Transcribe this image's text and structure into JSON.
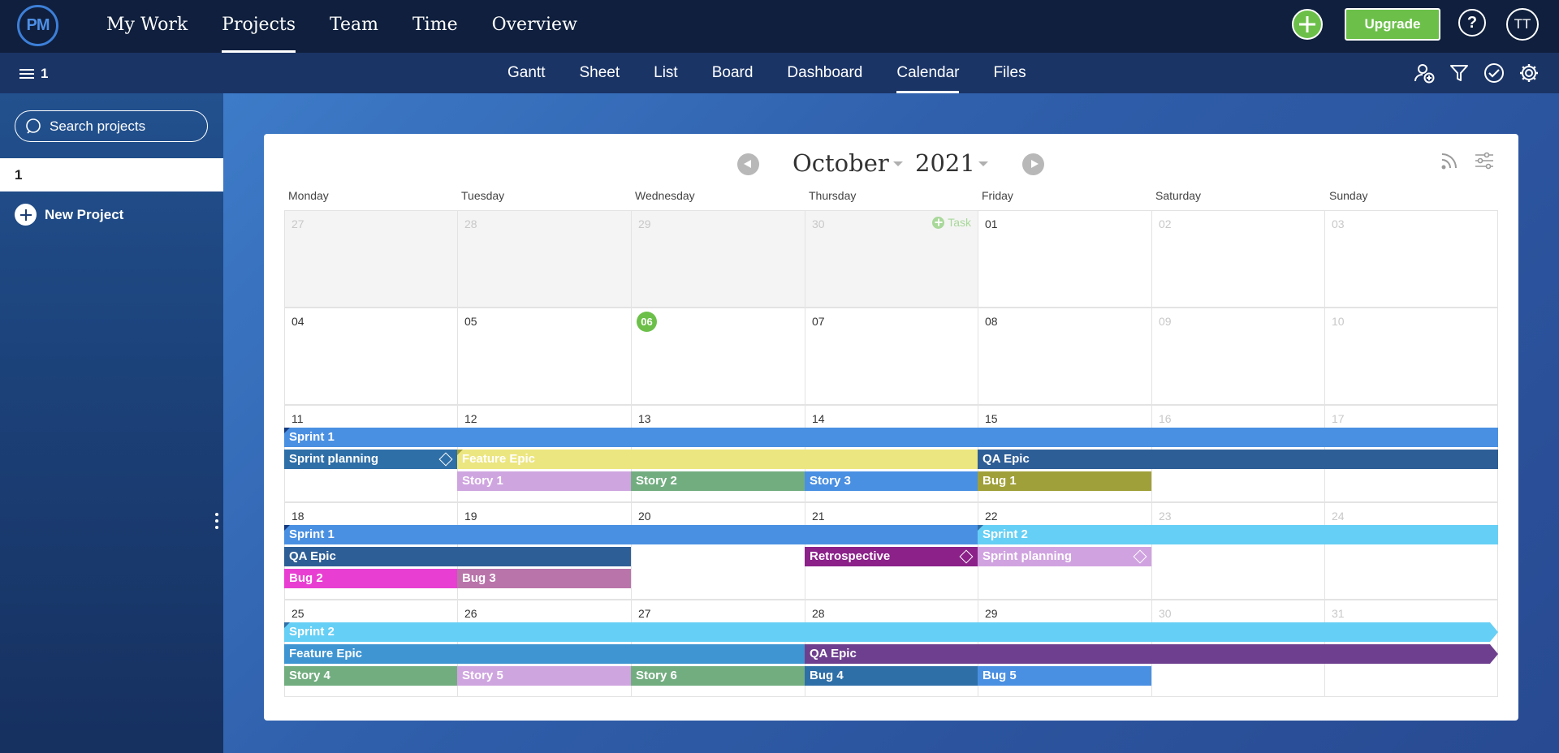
{
  "topnav": {
    "logo": "PM",
    "items": [
      "My Work",
      "Projects",
      "Team",
      "Time",
      "Overview"
    ],
    "active": "Projects",
    "upgrade": "Upgrade",
    "help": "?",
    "avatar": "TT"
  },
  "subnav": {
    "project_count": "1",
    "tabs": [
      "Gantt",
      "Sheet",
      "List",
      "Board",
      "Dashboard",
      "Calendar",
      "Files"
    ],
    "active_tab": "Calendar",
    "icons": [
      "add-user-icon",
      "filter-icon",
      "check-circle-icon",
      "gear-icon"
    ]
  },
  "sidebar": {
    "search_placeholder": "Search projects",
    "project": "1",
    "new_project": "New Project"
  },
  "calendar": {
    "month": "October",
    "year": "2021",
    "add_task": "Task",
    "day_headers": [
      "Monday",
      "Tuesday",
      "Wednesday",
      "Thursday",
      "Friday",
      "Saturday",
      "Sunday"
    ],
    "weeks": [
      [
        "27",
        "28",
        "29",
        "30",
        "01",
        "02",
        "03"
      ],
      [
        "04",
        "05",
        "06",
        "07",
        "08",
        "09",
        "10"
      ],
      [
        "11",
        "12",
        "13",
        "14",
        "15",
        "16",
        "17"
      ],
      [
        "18",
        "19",
        "20",
        "21",
        "22",
        "23",
        "24"
      ],
      [
        "25",
        "26",
        "27",
        "28",
        "29",
        "30",
        "31"
      ]
    ],
    "today": "06",
    "colors": {
      "sprint1": "#4a90e2",
      "sprint2": "#66cff5",
      "sprint_planning_1": "#2f6fa8",
      "sprint_planning_2": "#d0a3e0",
      "feature_epic_1": "#ece680",
      "feature_epic_2": "#3e95d2",
      "qa_epic_1": "#2e5e96",
      "qa_epic_3": "#6e3f8f",
      "story_purple": "#cfa5e0",
      "story_green": "#72ad80",
      "story_blue": "#4a90e2",
      "bug_olive": "#a0a03a",
      "bug_pink": "#e83fd2",
      "bug_mauve": "#b974aa",
      "bug_teal": "#2f6fa8",
      "retrospective": "#8b2189"
    },
    "events": [
      {
        "week": 2,
        "title": "Sprint 1"
      },
      {
        "week": 2,
        "title": "Sprint planning",
        "milestone": true
      },
      {
        "week": 2,
        "title": "Feature Epic"
      },
      {
        "week": 2,
        "title": "QA Epic"
      },
      {
        "week": 2,
        "title": "Story 1"
      },
      {
        "week": 2,
        "title": "Story 2"
      },
      {
        "week": 2,
        "title": "Story 3"
      },
      {
        "week": 2,
        "title": "Bug 1"
      },
      {
        "week": 3,
        "title": "Sprint 1"
      },
      {
        "week": 3,
        "title": "Sprint 2"
      },
      {
        "week": 3,
        "title": "QA Epic"
      },
      {
        "week": 3,
        "title": "Retrospective",
        "milestone": true
      },
      {
        "week": 3,
        "title": "Sprint planning",
        "milestone": true
      },
      {
        "week": 3,
        "title": "Bug 2"
      },
      {
        "week": 3,
        "title": "Bug 3"
      },
      {
        "week": 4,
        "title": "Sprint 2"
      },
      {
        "week": 4,
        "title": "Feature Epic"
      },
      {
        "week": 4,
        "title": "QA Epic"
      },
      {
        "week": 4,
        "title": "Story 4"
      },
      {
        "week": 4,
        "title": "Story 5"
      },
      {
        "week": 4,
        "title": "Story 6"
      },
      {
        "week": 4,
        "title": "Bug 4"
      },
      {
        "week": 4,
        "title": "Bug 5"
      }
    ]
  }
}
